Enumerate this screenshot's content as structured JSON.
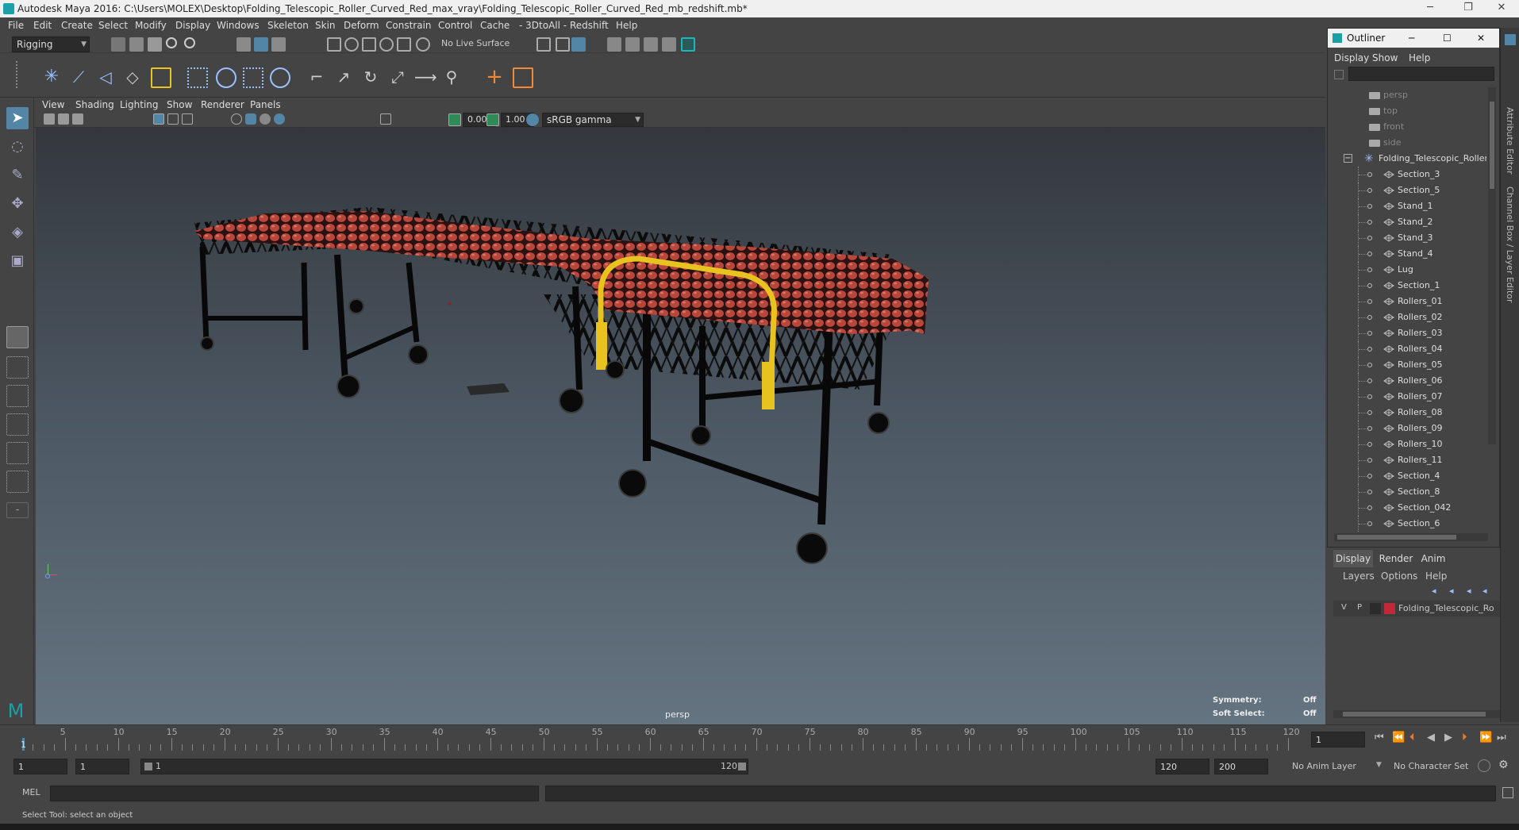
{
  "window": {
    "title": "Autodesk Maya 2016: C:\\Users\\MOLEX\\Desktop\\Folding_Telescopic_Roller_Curved_Red_max_vray\\Folding_Telescopic_Roller_Curved_Red_mb_redshift.mb*",
    "minimize": "─",
    "maximize": "❐",
    "close": "✕"
  },
  "menubar": [
    "File",
    "Edit",
    "Create",
    "Select",
    "Modify",
    "Display",
    "Windows",
    "Skeleton",
    "Skin",
    "Deform",
    "Constrain",
    "Control",
    "Cache",
    "- 3DtoAll -",
    "Redshift",
    "Help"
  ],
  "statusline": {
    "mode": "Rigging",
    "live_surface": "No Live Surface"
  },
  "viewport": {
    "menu": [
      "View",
      "Shading",
      "Lighting",
      "Show",
      "Renderer",
      "Panels"
    ],
    "exposure": "0.00",
    "gamma": "1.00",
    "color_space": "sRGB gamma",
    "camera_label": "persp",
    "hud": {
      "symmetry_label": "Symmetry:",
      "symmetry_value": "Off",
      "soft_select_label": "Soft Select:",
      "soft_select_value": "Off"
    }
  },
  "timeline": {
    "ticks": [
      "5",
      "10",
      "15",
      "20",
      "25",
      "30",
      "35",
      "40",
      "45",
      "50",
      "55",
      "60",
      "65",
      "70",
      "75",
      "80",
      "85",
      "90",
      "95",
      "100",
      "105",
      "110",
      "115",
      "120"
    ],
    "start_marker": "1",
    "current_frame": "1"
  },
  "range": {
    "start": "1",
    "playback_start": "1",
    "slider_start": "1",
    "slider_end": "120",
    "playback_end": "120",
    "end": "200",
    "anim_layer": "No Anim Layer",
    "character_set": "No Character Set"
  },
  "cmdline": {
    "label": "MEL"
  },
  "helpline": {
    "text": "Select Tool: select an object"
  },
  "outliner": {
    "title": "Outliner",
    "close": "✕",
    "minimize": "─",
    "maximize": "☐",
    "menu": [
      "Display",
      "Show",
      "Help"
    ],
    "cameras": [
      "persp",
      "top",
      "front",
      "side"
    ],
    "group": "Folding_Telescopic_Roller_",
    "items": [
      "Section_3",
      "Section_5",
      "Stand_1",
      "Stand_2",
      "Stand_3",
      "Stand_4",
      "Lug",
      "Section_1",
      "Rollers_01",
      "Rollers_02",
      "Rollers_03",
      "Rollers_04",
      "Rollers_05",
      "Rollers_06",
      "Rollers_07",
      "Rollers_08",
      "Rollers_09",
      "Rollers_10",
      "Rollers_11",
      "Section_4",
      "Section_8",
      "Section_042",
      "Section_6"
    ]
  },
  "layers": {
    "tabs": [
      "Display",
      "Render",
      "Anim"
    ],
    "menu": [
      "Layers",
      "Options",
      "Help"
    ],
    "row": {
      "v": "V",
      "p": "P",
      "name": "Folding_Telescopic_Ro",
      "color": "#c0293a"
    }
  },
  "side_tabs": [
    "Attribute Editor",
    "Channel Box / Layer Editor"
  ],
  "colors": {
    "accent": "#5285a6",
    "roller_red": "#b8463a",
    "handle_yellow": "#e8c31f"
  }
}
